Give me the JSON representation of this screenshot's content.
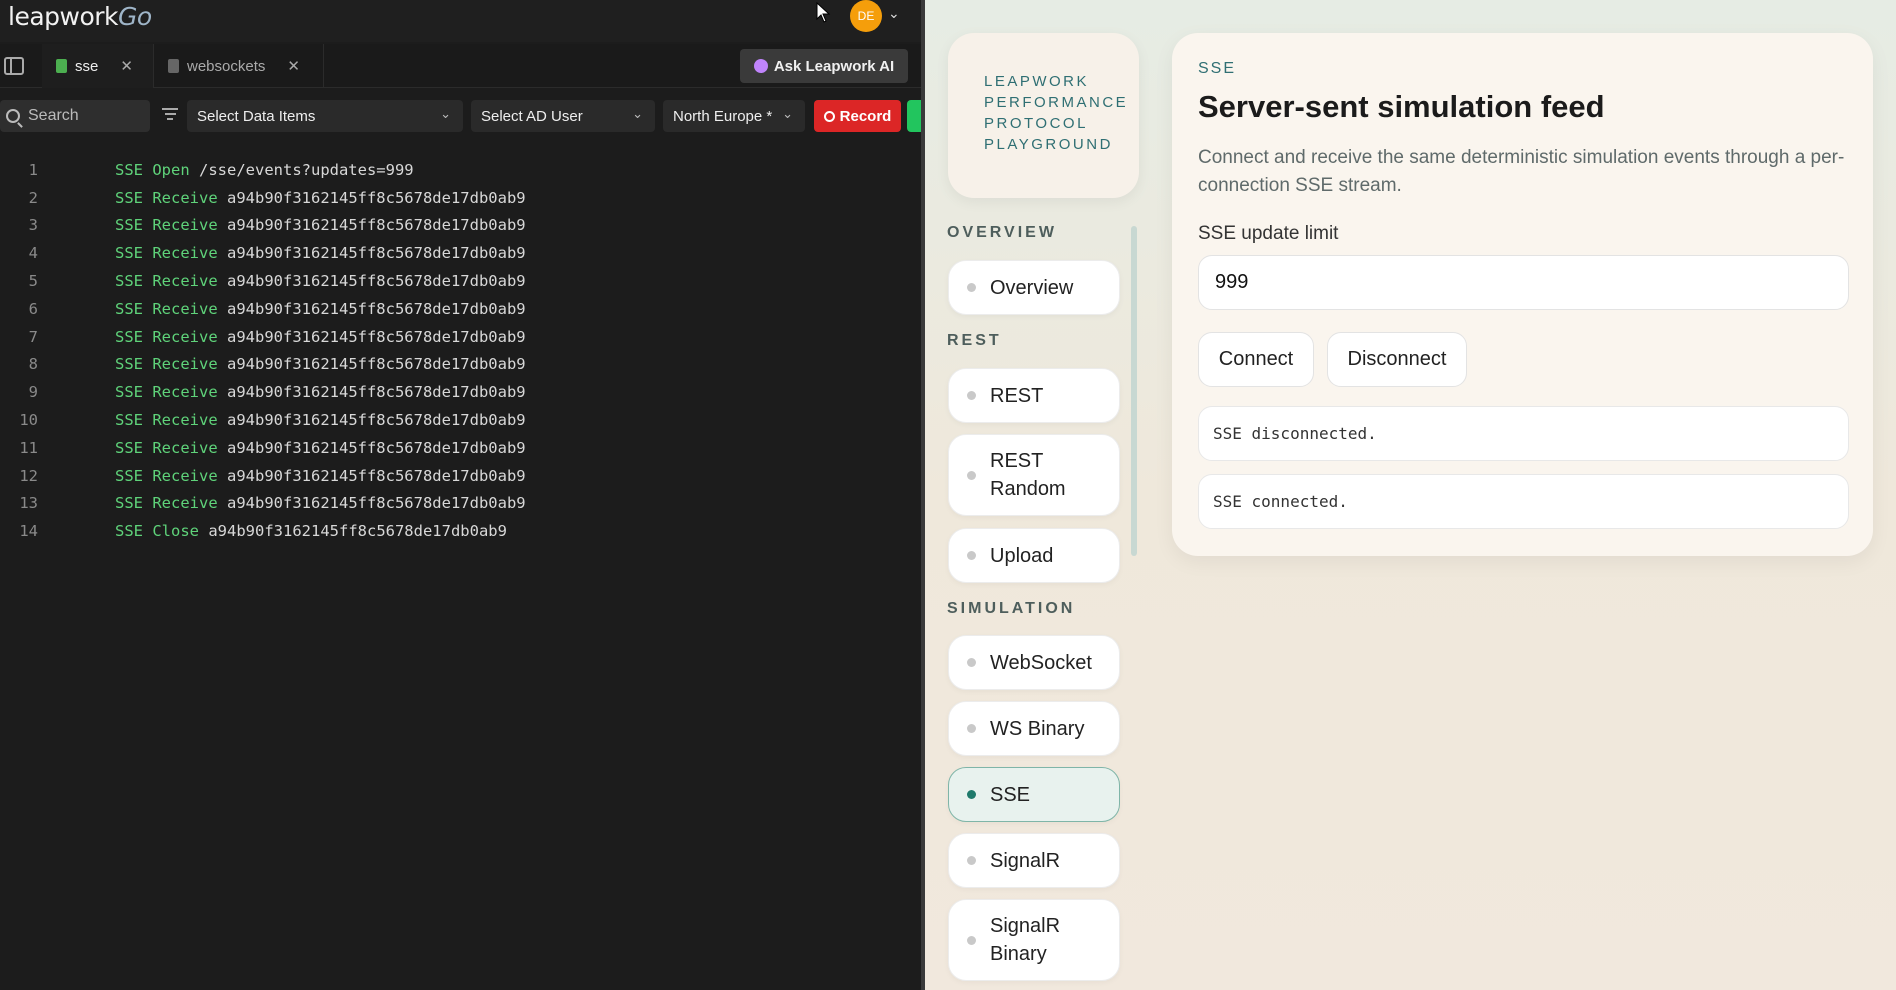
{
  "topbar": {
    "logo_text": "leapwork",
    "logo_suffix": "Go",
    "avatar_initials": "DE"
  },
  "tabs": [
    {
      "label": "sse",
      "active": true
    },
    {
      "label": "websockets",
      "active": false
    }
  ],
  "ask_ai_label": "Ask Leapwork AI",
  "toolbar": {
    "search_placeholder": "Search",
    "data_items": "Select Data Items",
    "ad_user": "Select AD User",
    "region": "North Europe *",
    "record_label": "Record"
  },
  "editor": {
    "lines": [
      {
        "n": "1",
        "kw": "SSE Open",
        "arg": "/sse/events?updates=999"
      },
      {
        "n": "2",
        "kw": "SSE Receive",
        "arg": "a94b90f3162145ff8c5678de17db0ab9"
      },
      {
        "n": "3",
        "kw": "SSE Receive",
        "arg": "a94b90f3162145ff8c5678de17db0ab9"
      },
      {
        "n": "4",
        "kw": "SSE Receive",
        "arg": "a94b90f3162145ff8c5678de17db0ab9"
      },
      {
        "n": "5",
        "kw": "SSE Receive",
        "arg": "a94b90f3162145ff8c5678de17db0ab9"
      },
      {
        "n": "6",
        "kw": "SSE Receive",
        "arg": "a94b90f3162145ff8c5678de17db0ab9"
      },
      {
        "n": "7",
        "kw": "SSE Receive",
        "arg": "a94b90f3162145ff8c5678de17db0ab9"
      },
      {
        "n": "8",
        "kw": "SSE Receive",
        "arg": "a94b90f3162145ff8c5678de17db0ab9"
      },
      {
        "n": "9",
        "kw": "SSE Receive",
        "arg": "a94b90f3162145ff8c5678de17db0ab9"
      },
      {
        "n": "10",
        "kw": "SSE Receive",
        "arg": "a94b90f3162145ff8c5678de17db0ab9"
      },
      {
        "n": "11",
        "kw": "SSE Receive",
        "arg": "a94b90f3162145ff8c5678de17db0ab9"
      },
      {
        "n": "12",
        "kw": "SSE Receive",
        "arg": "a94b90f3162145ff8c5678de17db0ab9"
      },
      {
        "n": "13",
        "kw": "SSE Receive",
        "arg": "a94b90f3162145ff8c5678de17db0ab9"
      },
      {
        "n": "14",
        "kw": "SSE Close",
        "arg": "a94b90f3162145ff8c5678de17db0ab9"
      }
    ]
  },
  "app": {
    "brand_lines": [
      "LEAPWORK",
      "PERFORMANCE",
      "PROTOCOL",
      "PLAYGROUND"
    ],
    "sections": {
      "overview": "OVERVIEW",
      "rest": "REST",
      "simulation": "SIMULATION"
    },
    "nav": {
      "overview": "Overview",
      "rest": "REST",
      "rest_random_1": "REST",
      "rest_random_2": "Random",
      "upload": "Upload",
      "websocket": "WebSocket",
      "ws_binary": "WS Binary",
      "sse": "SSE",
      "signalr": "SignalR",
      "signalr_binary_1": "SignalR",
      "signalr_binary_2": "Binary"
    },
    "card": {
      "eyebrow": "SSE",
      "title": "Server-sent simulation feed",
      "description": "Connect and receive the same deterministic simulation events through a per-connection SSE stream.",
      "limit_label": "SSE update limit",
      "limit_value": "999",
      "connect_label": "Connect",
      "disconnect_label": "Disconnect",
      "logs": [
        "SSE disconnected.",
        "SSE connected."
      ]
    }
  }
}
